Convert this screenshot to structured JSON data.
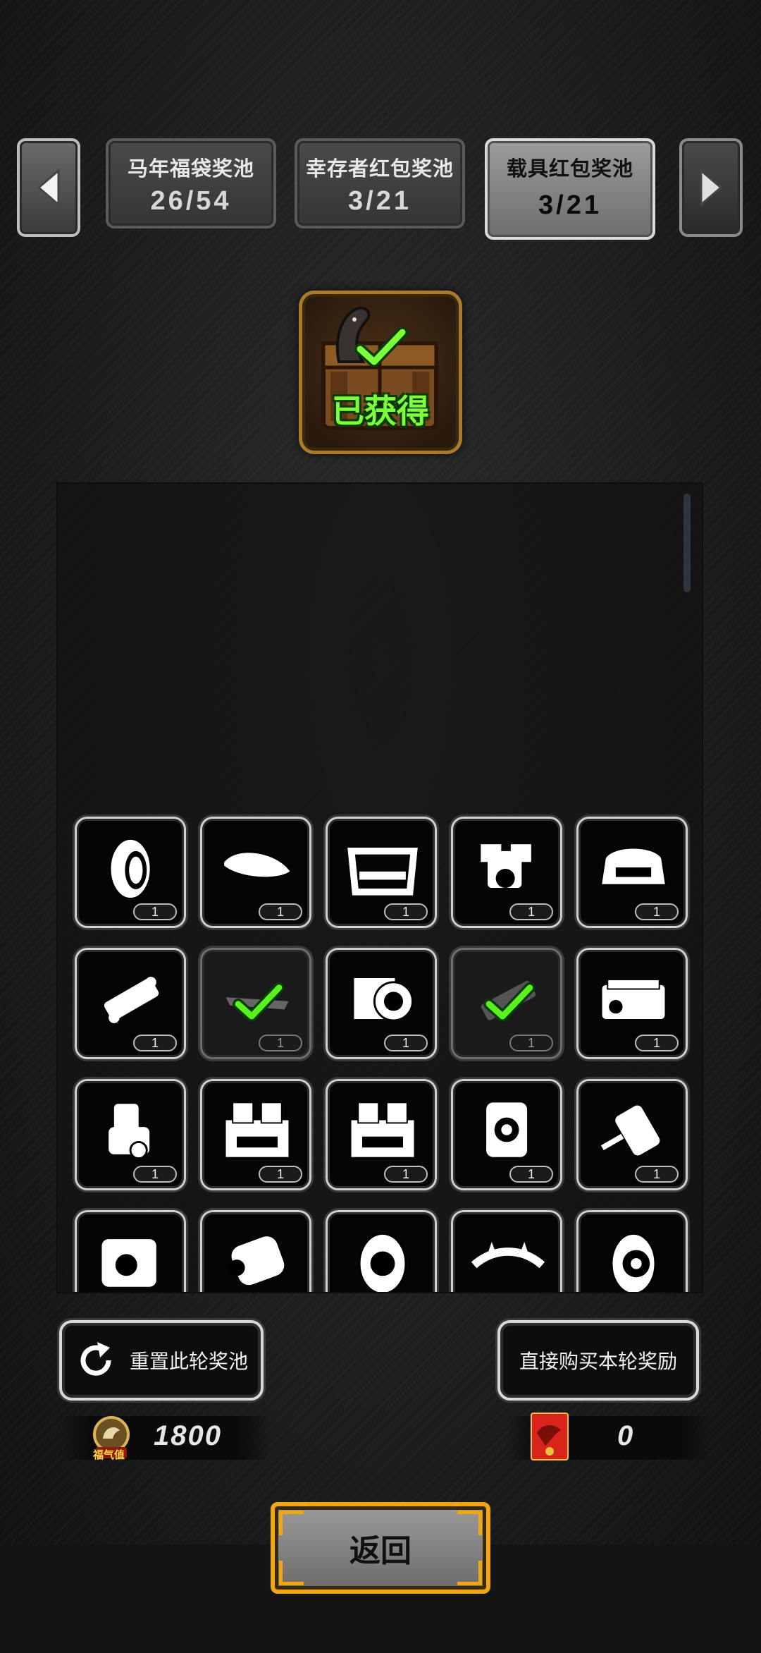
{
  "tabs": [
    {
      "title": "马年福袋奖池",
      "count": "26/54",
      "active": false
    },
    {
      "title": "幸存者红包奖池",
      "count": "3/21",
      "active": false
    },
    {
      "title": "载具红包奖池",
      "count": "3/21",
      "active": true
    }
  ],
  "nav": {
    "prev_icon": "left-arrow-icon",
    "next_icon": "right-arrow-icon"
  },
  "chest": {
    "label": "已获得",
    "icon": "horse-chest-icon"
  },
  "items": [
    {
      "icon": "tire-icon",
      "qty": "1",
      "obtained": false
    },
    {
      "icon": "roof-box-icon",
      "qty": "1",
      "obtained": false
    },
    {
      "icon": "bumper-icon",
      "qty": "1",
      "obtained": false
    },
    {
      "icon": "engine-v-icon",
      "qty": "1",
      "obtained": false
    },
    {
      "icon": "car-rear-icon",
      "qty": "1",
      "obtained": false
    },
    {
      "icon": "chassis-icon",
      "qty": "1",
      "obtained": false
    },
    {
      "icon": "spoiler-icon",
      "qty": "1",
      "obtained": true
    },
    {
      "icon": "engine-block-icon",
      "qty": "1",
      "obtained": false
    },
    {
      "icon": "shaft-icon",
      "qty": "1",
      "obtained": true
    },
    {
      "icon": "v8-engine-icon",
      "qty": "1",
      "obtained": false
    },
    {
      "icon": "motor-engine-icon",
      "qty": "1",
      "obtained": false
    },
    {
      "icon": "toolbox-icon",
      "qty": "1",
      "obtained": false
    },
    {
      "icon": "toolbox-icon",
      "qty": "1",
      "obtained": false
    },
    {
      "icon": "turbo-engine-icon",
      "qty": "1",
      "obtained": false
    },
    {
      "icon": "fuel-pump-icon",
      "qty": "1",
      "obtained": false
    },
    {
      "icon": "engine-icon",
      "qty": "",
      "obtained": false
    },
    {
      "icon": "filter-icon",
      "qty": "",
      "obtained": false
    },
    {
      "icon": "snow-chain-tire-icon",
      "qty": "",
      "obtained": false
    },
    {
      "icon": "spiked-bumper-icon",
      "qty": "",
      "obtained": false
    },
    {
      "icon": "sport-tire-icon",
      "qty": "",
      "obtained": false
    }
  ],
  "buttons": {
    "reset": "重置此轮奖池",
    "buy": "直接购买本轮奖励",
    "return": "返回"
  },
  "currency": {
    "fortune_value": "1800",
    "fortune_label": "福气值",
    "redpacket_value": "0"
  },
  "colors": {
    "accent_green": "#7cff3a",
    "gold": "#f1a614",
    "chest_border": "#a87a2c"
  }
}
